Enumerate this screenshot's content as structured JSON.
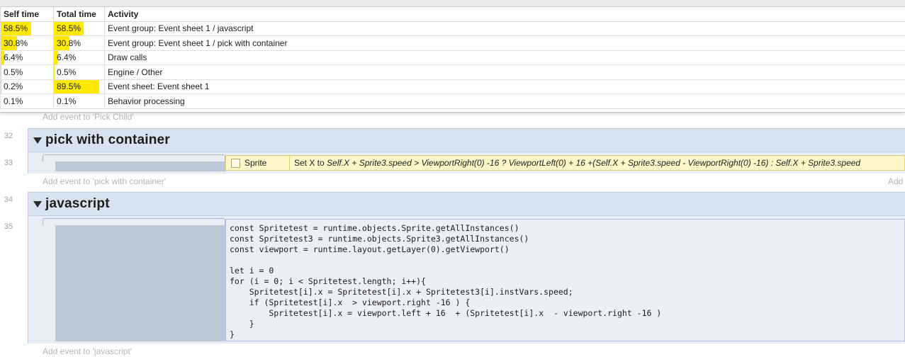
{
  "profiler": {
    "columns": [
      "Self time",
      "Total time",
      "Activity"
    ],
    "rows": [
      {
        "self": "58.5%",
        "self_frac": 0.585,
        "total": "58.5%",
        "total_frac": 0.585,
        "activity": "Event group: Event sheet 1 / javascript"
      },
      {
        "self": "30.8%",
        "self_frac": 0.308,
        "total": "30.8%",
        "total_frac": 0.308,
        "activity": "Event group: Event sheet 1 / pick with container"
      },
      {
        "self": "6.4%",
        "self_frac": 0.064,
        "total": "6.4%",
        "total_frac": 0.064,
        "activity": "Draw calls"
      },
      {
        "self": "0.5%",
        "self_frac": 0.005,
        "total": "0.5%",
        "total_frac": 0.005,
        "activity": "Engine / Other"
      },
      {
        "self": "0.2%",
        "self_frac": 0.002,
        "total": "89.5%",
        "total_frac": 0.895,
        "activity": "Event sheet: Event sheet 1"
      },
      {
        "self": "0.1%",
        "self_frac": 0.001,
        "total": "0.1%",
        "total_frac": 0.001,
        "activity": "Behavior processing"
      }
    ],
    "bar_color": "#ffea00"
  },
  "sheet": {
    "add_event_pick_child": "Add event to 'Pick Child'",
    "lines": {
      "g1": "32",
      "e1": "33",
      "g2": "34",
      "e2": "35"
    },
    "group1": {
      "title": "pick with container",
      "action_object": "Sprite",
      "action_prefix": "Set X to ",
      "action_expr": "Self.X + Sprite3.speed > ViewportRight(0) -16 ? ViewportLeft(0) + 16 +(Self.X + Sprite3.speed - ViewportRight(0) -16) : Self.X + Sprite3.speed",
      "add_event": "Add event to 'pick with container'",
      "add_right": "Add"
    },
    "group2": {
      "title": "javascript",
      "add_event": "Add event to 'javascript'",
      "code": [
        "const Spritetest = runtime.objects.Sprite.getAllInstances()",
        "const Spritetest3 = runtime.objects.Sprite3.getAllInstances()",
        "const viewport = runtime.layout.getLayer(0).getViewport()",
        "",
        "let i = 0",
        "for (i = 0; i < Spritetest.length; i++){",
        "    Spritetest[i].x = Spritetest[i].x + Spritetest3[i].instVars.speed;",
        "    if (Spritetest[i].x  > viewport.right -16 ) {",
        "        Spritetest[i].x = viewport.left + 16  + (Spritetest[i].x  - viewport.right -16 )",
        "    }",
        "}"
      ]
    }
  },
  "colors": {
    "group_header": "#d7e3f0",
    "action_bg": "#fff6c9",
    "script_bg": "#eceef9"
  }
}
